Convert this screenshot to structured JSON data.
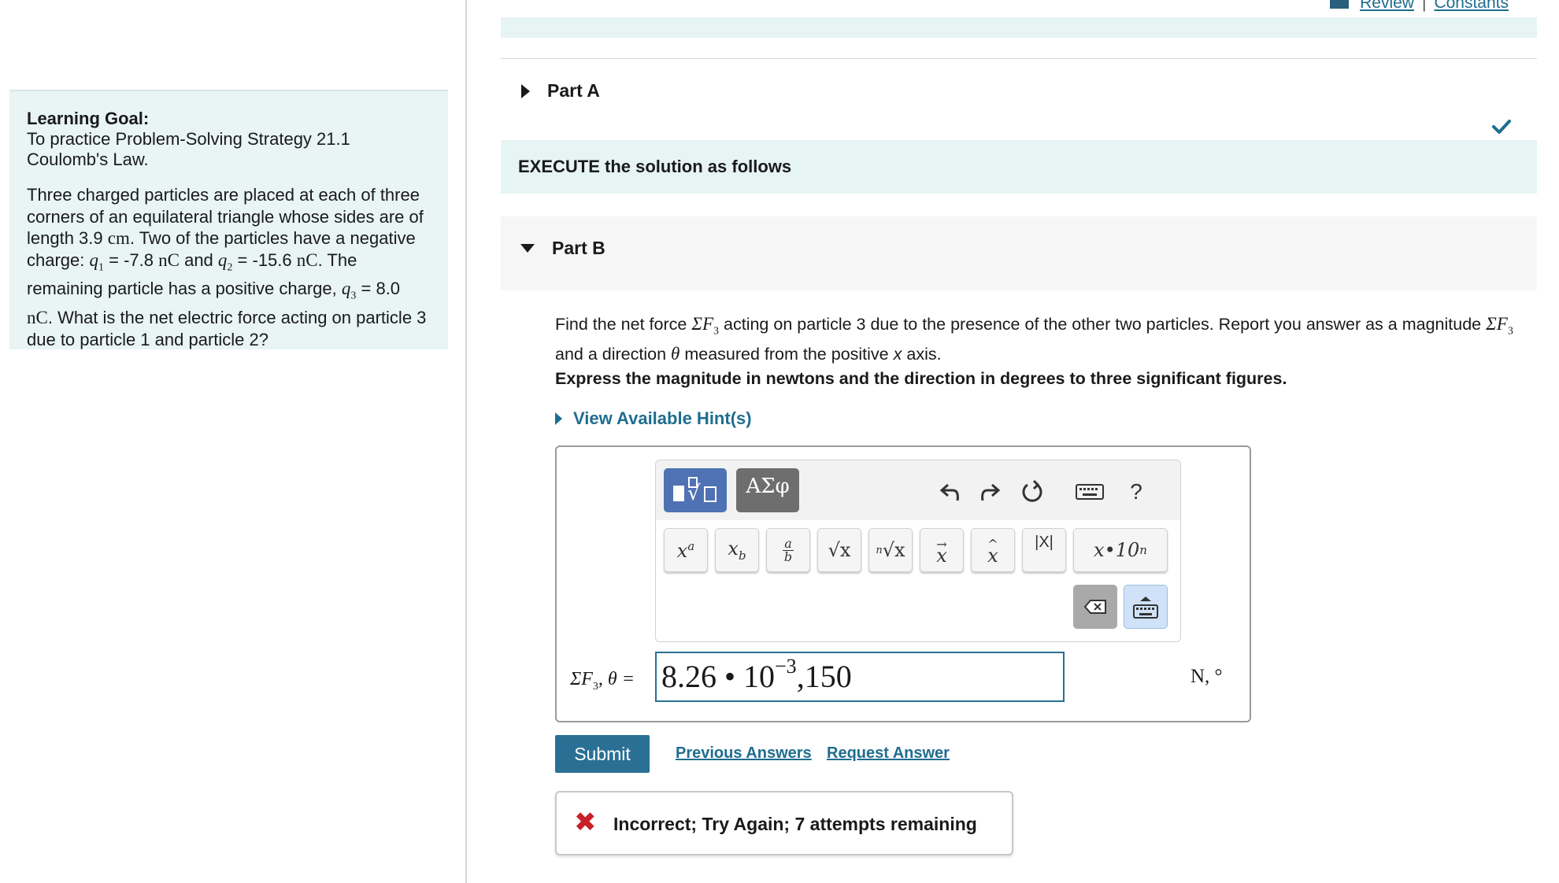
{
  "top_links": {
    "review": "Review",
    "separator": "|",
    "constants": "Constants"
  },
  "learning_goal": {
    "title": "Learning Goal:",
    "line1": "To practice Problem-Solving Strategy 21.1",
    "line2": "Coulomb's Law.",
    "problem": {
      "p1": "Three charged particles are placed at each of three corners of an equilateral triangle whose sides are of length 3.9",
      "length_unit": "cm",
      "p2": ". Two of the particles have a negative charge:",
      "q1_sym": "q",
      "q1_sub": "1",
      "q1_val": " = -7.8",
      "charge_unit": "nC",
      "and": " and",
      "q2_sym": "q",
      "q2_sub": "2",
      "q2_val": " = -15.6",
      "p3": ". The remaining particle has a positive charge,",
      "q3_sym": "q",
      "q3_sub": "3",
      "q3_val": " = 8.0",
      "p4": ". What is the net electric force acting on particle 3 due to particle 1 and particle 2?"
    }
  },
  "part_a": {
    "label": "Part A",
    "completed": true
  },
  "execute_band": "EXECUTE the solution as follows",
  "part_b": {
    "label": "Part B",
    "question": {
      "prefix": "Find the net force",
      "sum_symbol": "ΣF",
      "sub3": "3",
      "middle": "acting on particle 3 due to the presence of the other two particles. Report you answer as a magnitude",
      "and_dir": "and a direction",
      "theta": "θ",
      "measured": "measured from the positive",
      "x": "x",
      "axis": "axis."
    },
    "express": "Express the magnitude in newtons and the direction in degrees to three significant figures.",
    "hints": "View Available Hint(s)",
    "toolbar": {
      "greek": "ΑΣφ",
      "help": "?",
      "keys": {
        "superscript": "xa",
        "subscript": "xb",
        "fraction_num": "a",
        "fraction_den": "b",
        "sqrt": "√x",
        "nthroot_n": "n",
        "nthroot": "√x",
        "vector": "x",
        "unitvec": "x",
        "abs": "|X|",
        "sci": "x•10",
        "sci_exp": "n"
      }
    },
    "answer": {
      "label_sum": "ΣF",
      "label_sub": "3",
      "label_rest": ", θ =",
      "value_base": "8.26 • 10",
      "value_exp": "−3",
      "value_tail": ",150",
      "units": "N, °"
    },
    "submit": "Submit",
    "previous_answers": "Previous Answers",
    "request_answer": "Request Answer",
    "feedback": "Incorrect; Try Again; 7 attempts remaining"
  },
  "colors": {
    "accent": "#1f6d8f",
    "band": "#e6f4f3",
    "submit": "#2a7095",
    "error": "#c8202a",
    "template_btn": "#4f72b4"
  }
}
